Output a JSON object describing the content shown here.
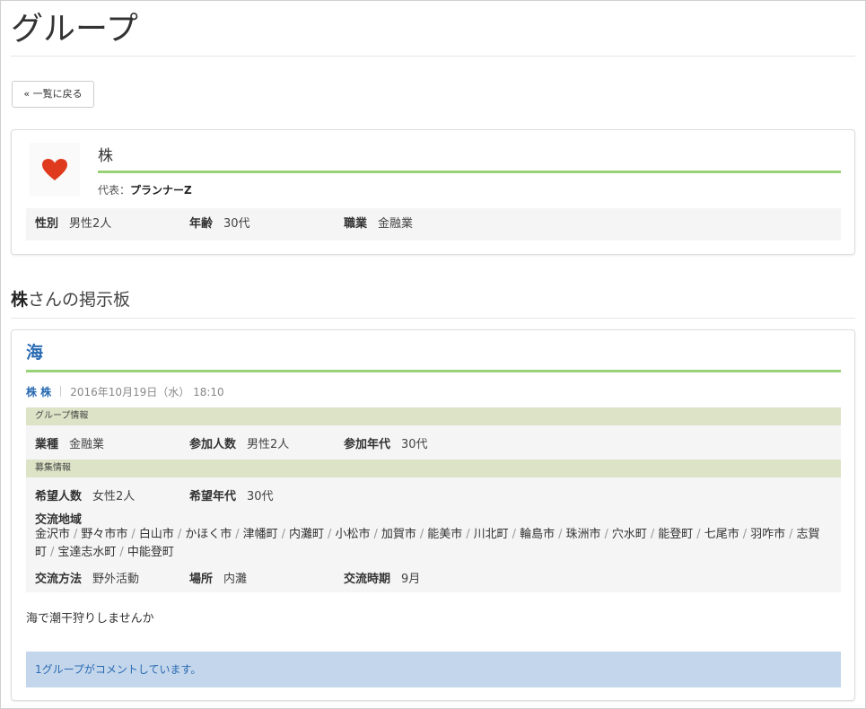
{
  "page": {
    "title": "グループ"
  },
  "back_button": {
    "label": "« 一覧に戻る"
  },
  "group": {
    "name": "株",
    "icon": "heart-icon",
    "representative_label": "代表：",
    "representative_name": "プランナーZ",
    "gender_label": "性別",
    "gender_value": "男性2人",
    "age_label": "年齢",
    "age_value": "30代",
    "job_label": "職業",
    "job_value": "金融業"
  },
  "board": {
    "owner": "株",
    "suffix": "さんの掲示板"
  },
  "post": {
    "title": "海",
    "author": "株 株",
    "date": "2016年10月19日（水） 18:10",
    "group_info": {
      "heading": "グループ情報",
      "industry_label": "業種",
      "industry_value": "金融業",
      "members_label": "参加人数",
      "members_value": "男性2人",
      "age_label": "参加年代",
      "age_value": "30代"
    },
    "recruit": {
      "heading": "募集情報",
      "wanted_label": "希望人数",
      "wanted_value": "女性2人",
      "wanted_age_label": "希望年代",
      "wanted_age_value": "30代",
      "area_label": "交流地域",
      "areas": [
        "金沢市",
        "野々市市",
        "白山市",
        "かほく市",
        "津幡町",
        "内灘町",
        "小松市",
        "加賀市",
        "能美市",
        "川北町",
        "輪島市",
        "珠洲市",
        "穴水町",
        "能登町",
        "七尾市",
        "羽咋市",
        "志賀町",
        "宝達志水町",
        "中能登町"
      ],
      "method_label": "交流方法",
      "method_value": "野外活動",
      "place_label": "場所",
      "place_value": "内灘",
      "period_label": "交流時期",
      "period_value": "9月"
    },
    "message": "海で潮干狩りしませんか",
    "comment_status": "1グループがコメントしています。"
  },
  "colors": {
    "accent_green": "#9ad27a",
    "link_blue": "#2a6bb3",
    "heart_red": "#e03a1e"
  }
}
